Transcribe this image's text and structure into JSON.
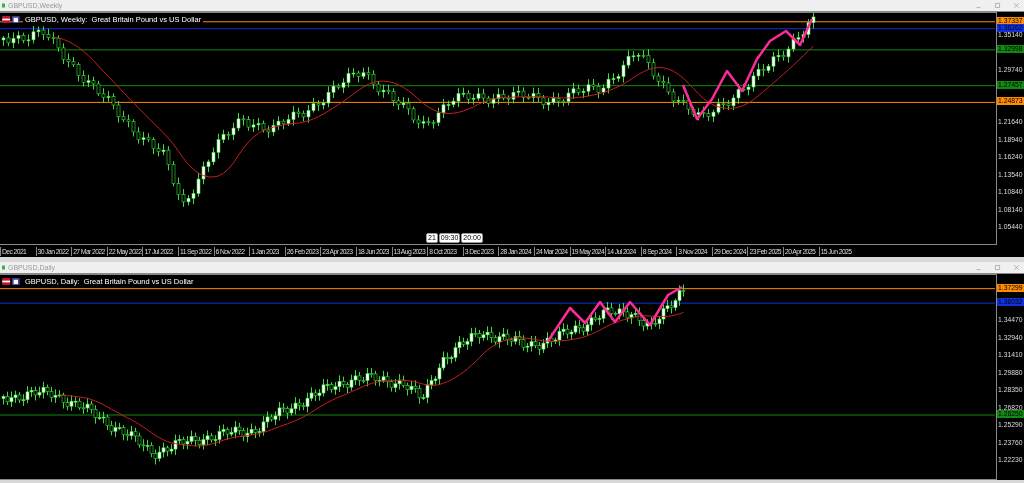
{
  "windows": [
    {
      "kind": "weekly",
      "title": "GBPUSD,Weekly",
      "caption": "GBPUSD, Weekly:  Great Britain Pound vs US Dollar",
      "price_labels": [
        "1.35140",
        "1.29740",
        "1.21640",
        "1.18940",
        "1.16240",
        "1.13540",
        "1.10840",
        "1.08140",
        "1.05440"
      ],
      "price_tags": [
        {
          "text": "1.37337",
          "color": "#ff8c00"
        },
        {
          "text": "1.36262",
          "color": "#1030e0"
        },
        {
          "text": "1.32998",
          "color": "#128a12"
        },
        {
          "text": "1.27457",
          "color": "#128a12"
        },
        {
          "text": "1.24873",
          "color": "#ff8c00"
        }
      ],
      "dates": [
        "Dec 2021",
        "30 Jan 2022",
        "27 Mar 2022",
        "22 May 2022",
        "17 Jul 2022",
        "11 Sep 2022",
        "6 Nov 2022",
        "1 Jan 2023",
        "26 Feb 2023",
        "23 Apr 2023",
        "18 Jun 2023",
        "13 Aug 2023",
        "8 Oct 2023",
        "3 Dec 2023",
        "28 Jan 2024",
        "24 Mar 2024",
        "19 May 2024",
        "14 Jul 2024",
        "8 Sep 2024",
        "3 Nov 2024",
        "29 Dec 2024",
        "23 Feb 2025",
        "20 Apr 2025",
        "15 Jun 2025"
      ],
      "time_tags": [
        "21",
        "09:30",
        "20:00"
      ]
    },
    {
      "kind": "daily",
      "title": "GBPUSD,Daily",
      "caption": "GBPUSD, Daily:  Great Britain Pound vs US Dollar",
      "price_labels": [
        "1.34470",
        "1.32940",
        "1.31410",
        "1.29880",
        "1.28350",
        "1.26820",
        "1.25290",
        "1.23760",
        "1.22230"
      ],
      "price_tags": [
        {
          "text": "1.37299",
          "color": "#ff8c00"
        },
        {
          "text": "1.36032",
          "color": "#1030e0"
        },
        {
          "text": "1.26250",
          "color": "#128a12"
        }
      ]
    }
  ]
}
